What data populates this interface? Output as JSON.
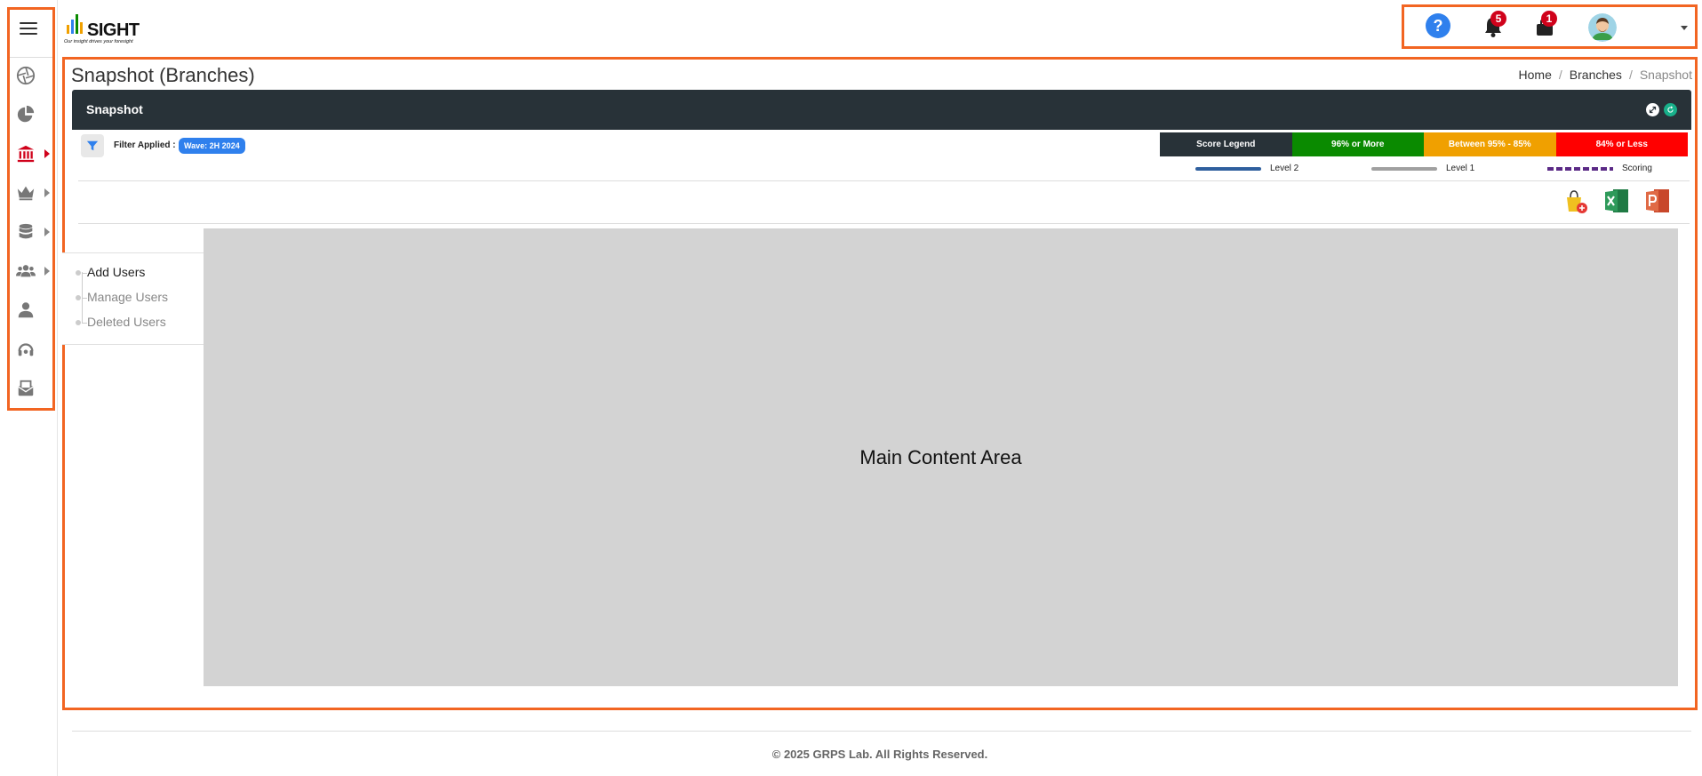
{
  "app": {
    "logo_word": "SIGHT",
    "logo_tagline": "Our insight drives your foresight"
  },
  "header": {
    "help_glyph": "?",
    "notifications_count": "5",
    "messages_count": "1"
  },
  "page": {
    "title": "Snapshot (Branches)",
    "breadcrumb": [
      "Home",
      "Branches",
      "Snapshot"
    ]
  },
  "card": {
    "title": "Snapshot"
  },
  "filter": {
    "label": "Filter Applied :",
    "chip": "Wave: 2H 2024"
  },
  "legend": {
    "items": [
      {
        "label": "Score Legend",
        "color": "#283238"
      },
      {
        "label": "96% or More",
        "color": "#0a8a00"
      },
      {
        "label": "Between 95% - 85%",
        "color": "#f0a000"
      },
      {
        "label": "84% or Less",
        "color": "#ff0000"
      }
    ],
    "lines": [
      {
        "label": "Level 2",
        "color": "#2f5f9e",
        "style": "solid"
      },
      {
        "label": "Level 1",
        "color": "#a0a0a0",
        "style": "solid"
      },
      {
        "label": "Scoring",
        "color": "#5b2a86",
        "style": "dashed"
      }
    ]
  },
  "exports": [
    "add-to-bag-icon",
    "excel-icon",
    "powerpoint-icon"
  ],
  "user_menu": {
    "items": [
      "Add Users",
      "Manage Users",
      "Deleted Users"
    ]
  },
  "content": {
    "placeholder": "Main Content Area"
  },
  "footer": {
    "text": "© 2025 GRPS Lab. All Rights Reserved."
  },
  "colors": {
    "accent_outline": "#f26522",
    "header_dark": "#283238",
    "brand_blue": "#2f80ed",
    "active_red": "#d0021b"
  }
}
